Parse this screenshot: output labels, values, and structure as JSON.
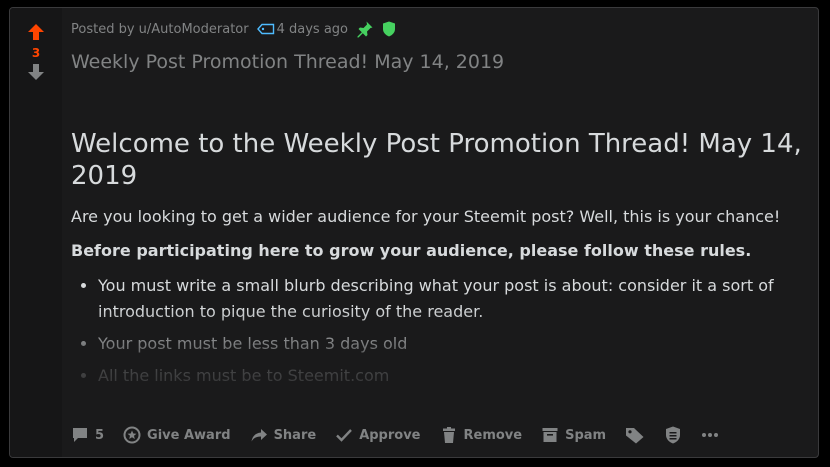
{
  "vote": {
    "count": "3"
  },
  "meta": {
    "posted_by": "Posted by u/AutoModerator",
    "time_ago": "4 days ago"
  },
  "post": {
    "title": "Weekly Post Promotion Thread! May 14, 2019"
  },
  "body": {
    "heading": "Welcome to the Weekly Post Promotion Thread! May 14, 2019",
    "intro": "Are you looking to get a wider audience for your Steemit post? Well, this is your chance!",
    "rules_intro": "Before participating here to grow your audience, please follow these rules.",
    "rules": [
      "You must write a small blurb describing what your post is about: consider it a sort of introduction to pique the curiosity of the reader.",
      "Your post must be less than 3 days old",
      "All the links must be to Steemit.com"
    ]
  },
  "actions": {
    "comments": "5",
    "give_award": "Give Award",
    "share": "Share",
    "approve": "Approve",
    "remove": "Remove",
    "spam": "Spam"
  },
  "colors": {
    "upvote": "#ff4500",
    "pin": "#46d160",
    "mod_shield": "#46d160",
    "muted": "#818384",
    "text": "#d7dadc"
  }
}
